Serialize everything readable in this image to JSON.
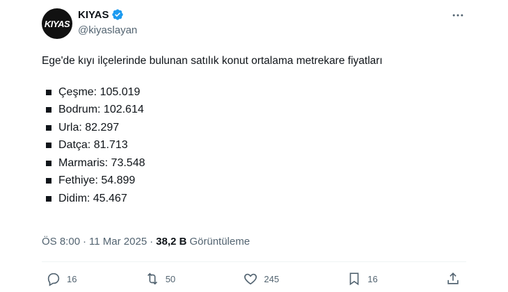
{
  "header": {
    "avatar_text": "KIYAS",
    "display_name": "KIYAS",
    "handle": "@kiyaslayan"
  },
  "tweet": {
    "intro": "Ege'de kıyı ilçelerinde bulunan satılık konut ortalama metrekare fiyatları",
    "items": [
      {
        "label": "Çeşme: 105.019"
      },
      {
        "label": "Bodrum: 102.614"
      },
      {
        "label": "Urla: 82.297"
      },
      {
        "label": "Datça: 81.713"
      },
      {
        "label": "Marmaris: 73.548"
      },
      {
        "label": "Fethiye: 54.899"
      },
      {
        "label": "Didim: 45.467"
      }
    ]
  },
  "meta": {
    "time": "ÖS 8:00",
    "sep1": "·",
    "date": "11 Mar 2025",
    "sep2": "·",
    "views_count": "38,2 B",
    "views_label": "Görüntüleme"
  },
  "actions": {
    "replies": "16",
    "reposts": "50",
    "likes": "245",
    "bookmarks": "16"
  },
  "colors": {
    "text": "#0f1419",
    "muted": "#536471",
    "verified": "#1d9bf0",
    "divider": "#eff3f4"
  },
  "icons": [
    "verified-badge-icon",
    "more-icon",
    "reply-icon",
    "repost-icon",
    "like-icon",
    "bookmark-icon",
    "share-icon"
  ]
}
